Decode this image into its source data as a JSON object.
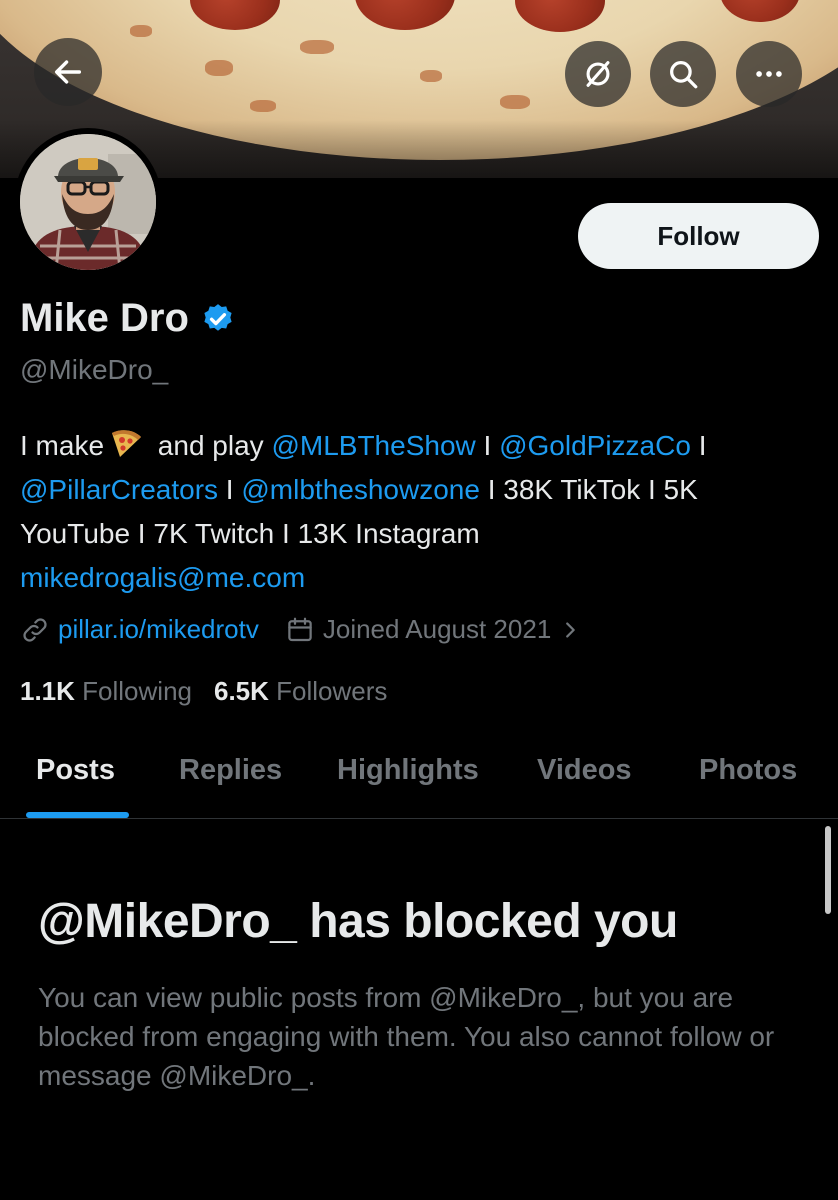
{
  "header": {
    "back_icon": "arrow-left-icon",
    "grok_icon": "grok-slash-icon",
    "search_icon": "search-icon",
    "more_icon": "more-horizontal-icon"
  },
  "profile": {
    "name": "Mike Dro",
    "handle": "@MikeDro_",
    "verified": true,
    "follow_label": "Follow",
    "bio": {
      "part1": "I make",
      "emoji": "pizza-emoji",
      "part2": " and play ",
      "mention1": "@MLBTheShow",
      "sep1": " I ",
      "mention2": "@GoldPizzaCo",
      "sep2": " I",
      "mention3": "@PillarCreators",
      "sep3": " I ",
      "mention4": "@mlbtheshowzone",
      "rest": " I 38K TikTok I 5K YouTube I 7K Twitch I 13K Instagram",
      "email": "mikedrogalis@me.com"
    },
    "website": "pillar.io/mikedrotv",
    "joined": "Joined August 2021",
    "following_count": "1.1K",
    "following_label": "Following",
    "followers_count": "6.5K",
    "followers_label": "Followers"
  },
  "tabs": [
    {
      "label": "Posts",
      "active": true
    },
    {
      "label": "Replies",
      "active": false
    },
    {
      "label": "Highlights",
      "active": false
    },
    {
      "label": "Videos",
      "active": false
    },
    {
      "label": "Photos",
      "active": false
    }
  ],
  "blocked": {
    "title": "@MikeDro_ has blocked you",
    "message": "You can view public posts from @MikeDro_, but you are blocked from engaging with them. You also cannot follow or message @MikeDro_."
  },
  "colors": {
    "background": "#000000",
    "accent": "#1d9bf0",
    "text_primary": "#e7e9ea",
    "text_secondary": "#71767b",
    "follow_button": "#eff3f4"
  }
}
